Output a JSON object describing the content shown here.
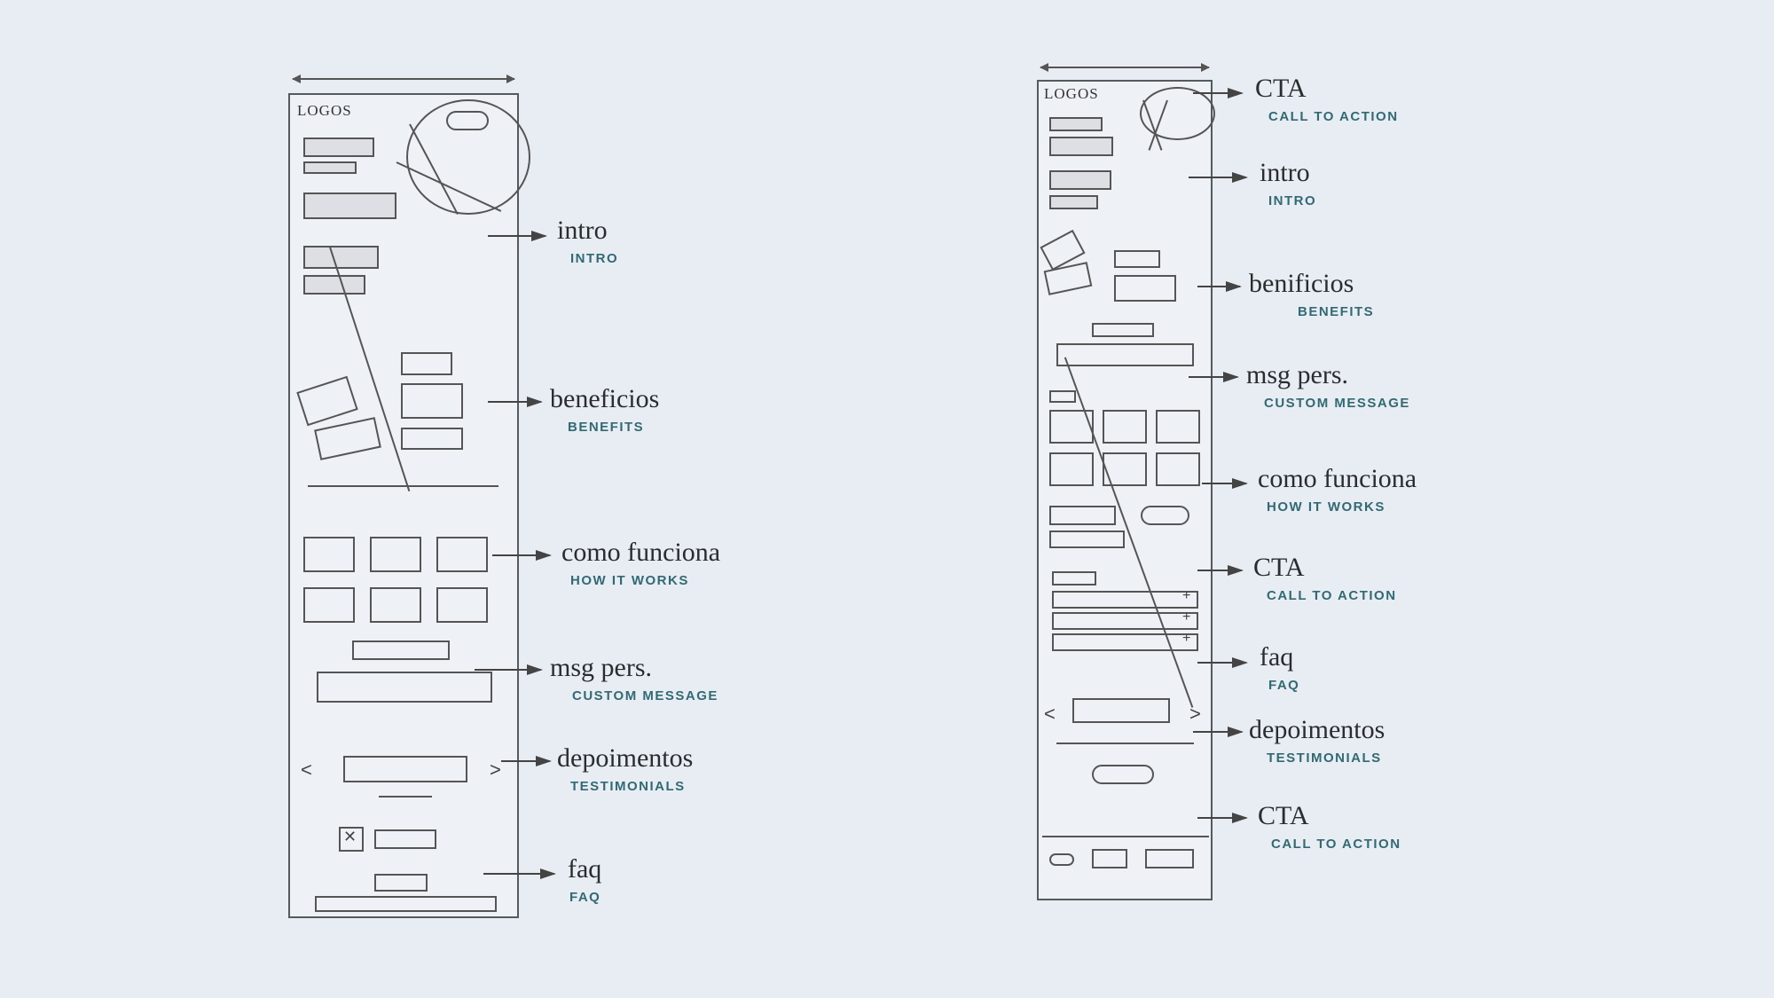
{
  "left": {
    "logos": "LOGOS",
    "sections": [
      {
        "script": "intro",
        "caption": "INTRO"
      },
      {
        "script": "beneficios",
        "caption": "BENEFITS"
      },
      {
        "script": "como funciona",
        "caption": "HOW IT WORKS"
      },
      {
        "script": "msg pers.",
        "caption": "CUSTOM MESSAGE"
      },
      {
        "script": "depoimentos",
        "caption": "TESTIMONIALS"
      },
      {
        "script": "faq",
        "caption": "FAQ"
      }
    ]
  },
  "right": {
    "logos": "LOGOS",
    "sections": [
      {
        "script": "CTA",
        "caption": "CALL TO ACTION"
      },
      {
        "script": "intro",
        "caption": "INTRO"
      },
      {
        "script": "benificios",
        "caption": "BENEFITS"
      },
      {
        "script": "msg pers.",
        "caption": "CUSTOM MESSAGE"
      },
      {
        "script": "como funciona",
        "caption": "HOW IT WORKS"
      },
      {
        "script": "CTA",
        "caption": "CALL TO ACTION"
      },
      {
        "script": "faq",
        "caption": "FAQ"
      },
      {
        "script": "depoimentos",
        "caption": "TESTIMONIALS"
      },
      {
        "script": "CTA",
        "caption": "CALL TO ACTION"
      }
    ]
  }
}
